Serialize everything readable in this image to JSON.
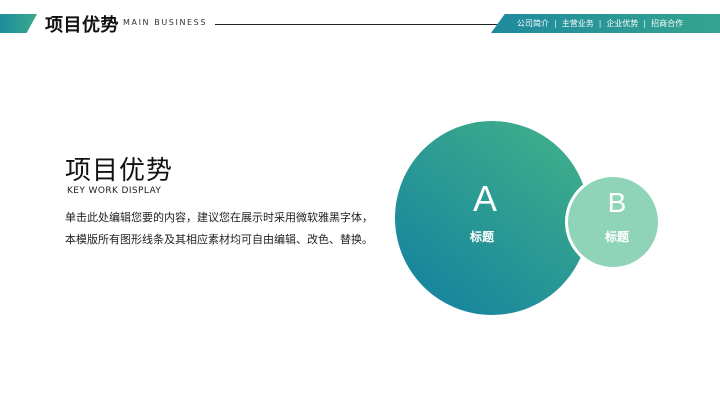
{
  "header": {
    "title": "项目优势",
    "subtitle": "MAIN BUSINESS",
    "nav": [
      "公司简介",
      "主营业务",
      "企业优势",
      "招商合作"
    ],
    "nav_separator": "|"
  },
  "content": {
    "title": "项目优势",
    "subtitle": "KEY WORK DISPLAY",
    "description": "单击此处编辑您要的内容，建议您在展示时采用微软雅黑字体，本模版所有图形线条及其相应素材均可自由编辑、改色、替换。"
  },
  "diagram": {
    "circle_a": {
      "letter": "A",
      "label": "标题"
    },
    "circle_b": {
      "letter": "B",
      "label": "标题"
    }
  },
  "colors": {
    "accent_teal": "#1e8c9a",
    "accent_green": "#3aa98c",
    "circle_b_fill": "#8fd4b8"
  }
}
